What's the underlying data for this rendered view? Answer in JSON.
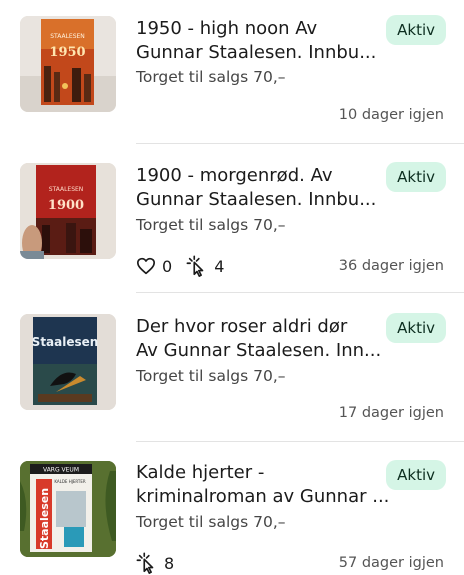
{
  "listings": [
    {
      "title_line1": "1950 - high noon Av",
      "title_line2": "Gunnar Staalesen. Innbu...",
      "price": "Torget til salgs 70,–",
      "status": "Aktiv",
      "time_left": "10 dager igjen",
      "cover": {
        "author": "STAALESEN",
        "year": "1950"
      }
    },
    {
      "title_line1": "1900 - morgenrød. Av",
      "title_line2": "Gunnar Staalesen. Innbu...",
      "price": "Torget til salgs 70,–",
      "status": "Aktiv",
      "time_left": "36 dager igjen",
      "likes": "0",
      "clicks": "4",
      "cover": {
        "author": "STAALESEN",
        "year": "1900"
      }
    },
    {
      "title_line1": "Der hvor roser aldri dør",
      "title_line2": "Av Gunnar Staalesen. Inn...",
      "price": "Torget til salgs 70,–",
      "status": "Aktiv",
      "time_left": "17 dager igjen",
      "cover": {
        "author": "Staalesen",
        "year": ""
      }
    },
    {
      "title_line1": "Kalde hjerter -",
      "title_line2": "kriminalroman av Gunnar ...",
      "price": "Torget til salgs 70,–",
      "status": "Aktiv",
      "time_left": "57 dager igjen",
      "clicks": "8",
      "cover": {
        "author": "Staalesen",
        "year": "",
        "header": "VARG VEUM",
        "subtitle": "KALDE HJERTER"
      }
    }
  ],
  "colors": {
    "badge_bg": "#d5f5e6",
    "badge_text": "#0d2e20",
    "divider": "#e3e3e3"
  }
}
